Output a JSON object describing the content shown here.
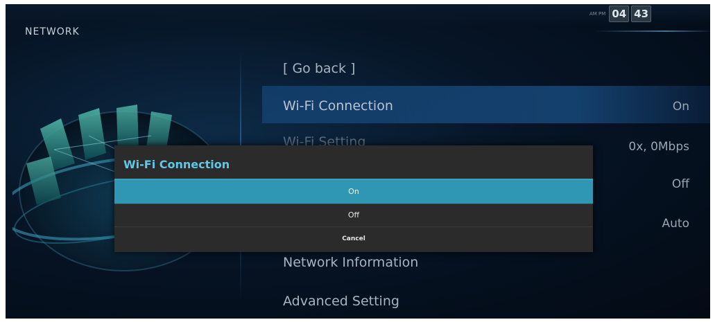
{
  "header": {
    "section_title": "NETWORK",
    "clock": {
      "ampm": "AM PM",
      "hour": "04",
      "minute": "43"
    }
  },
  "menu": {
    "items": [
      {
        "label": "[ Go back ]",
        "value": ""
      },
      {
        "label": "Wi-Fi Connection",
        "value": "On"
      },
      {
        "label": "Wi-Fi Setting",
        "value": "0x, 0Mbps"
      },
      {
        "label": "",
        "value": "Off"
      },
      {
        "label": "",
        "value": "Auto"
      },
      {
        "label": "Network Information",
        "value": ""
      },
      {
        "label": "Advanced Setting",
        "value": ""
      }
    ]
  },
  "dialog": {
    "title": "Wi-Fi Connection",
    "options": [
      {
        "label": "On",
        "selected": true
      },
      {
        "label": "Off",
        "selected": false
      },
      {
        "label": "Cancel",
        "selected": false
      }
    ]
  },
  "colors": {
    "accent": "#2f97b4",
    "dialog_title": "#5fc8e6",
    "dialog_bg": "#2b2b2b",
    "background": "#061425"
  },
  "icons": [
    "network-globe-icon"
  ]
}
